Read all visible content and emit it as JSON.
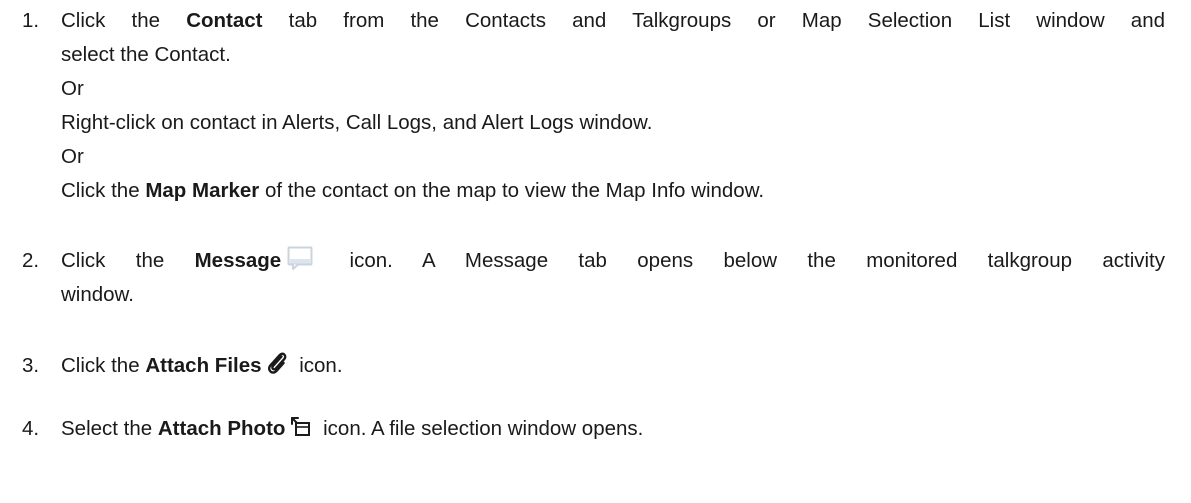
{
  "steps": [
    {
      "number": "1.",
      "lines": {
        "l1_a": "Click the ",
        "l1_b": "Contact",
        "l1_c": " tab from the Contacts and Talkgroups or Map Selection List window and",
        "l2": "select the Contact.",
        "or1": "Or",
        "l3": "Right-click on contact in Alerts, Call Logs, and Alert Logs window.",
        "or2": "Or",
        "l4_a": "Click the ",
        "l4_b": "Map Marker",
        "l4_c": " of the contact on the map to view the Map Info window."
      }
    },
    {
      "number": "2.",
      "lines": {
        "a": "Click the ",
        "b": "Message",
        "c": " icon. A Message tab opens below the monitored talkgroup activity",
        "d": "window."
      },
      "icon": "message-icon"
    },
    {
      "number": "3.",
      "lines": {
        "a": "Click the ",
        "b": "Attach Files",
        "c": " icon."
      },
      "icon": "paperclip-icon"
    },
    {
      "number": "4.",
      "lines": {
        "a": "Select the ",
        "b": "Attach Photo",
        "c": " icon. A file selection window opens."
      },
      "icon": "attach-photo-icon"
    }
  ],
  "colors": {
    "text": "#1a1a1a",
    "message_icon": "#c9d4dd"
  }
}
